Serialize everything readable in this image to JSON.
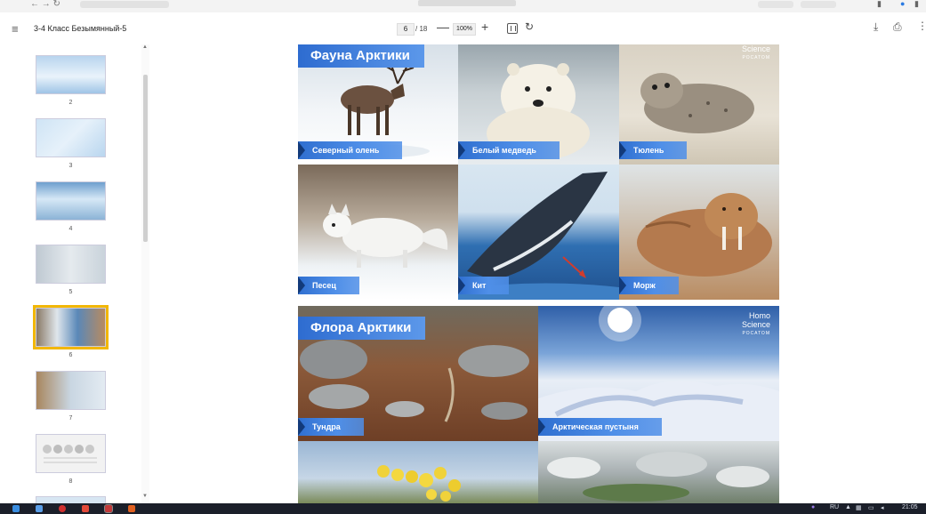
{
  "browser": {
    "nav_icons": "← →  ↻"
  },
  "toolbar": {
    "menu_icon": "≡",
    "doc_title": "3-4 Класс Безымянный-5",
    "current_page": "6",
    "page_total": "/ 18",
    "zoom_out": "—",
    "zoom": "100%",
    "zoom_in": "+",
    "rotate_icon": "↻",
    "download_icon": "⤓",
    "print_icon": "⎙",
    "more_icon": "⋮"
  },
  "sidebar": {
    "thumbnails": [
      {
        "num": "2"
      },
      {
        "num": "3"
      },
      {
        "num": "4"
      },
      {
        "num": "5"
      },
      {
        "num": "6",
        "selected": true
      },
      {
        "num": "7"
      },
      {
        "num": "8"
      }
    ]
  },
  "slide_fauna": {
    "title": "Фауна Арктики",
    "logo_line1": "Science",
    "logo_line2": "РОСАТОМ",
    "cells": [
      {
        "caption": "Северный олень"
      },
      {
        "caption": "Белый медведь"
      },
      {
        "caption": "Тюлень"
      },
      {
        "caption": "Песец"
      },
      {
        "caption": "Кит"
      },
      {
        "caption": "Морж"
      }
    ]
  },
  "slide_flora": {
    "title": "Флора Арктики",
    "logo_line1": "Homo",
    "logo_line2": "Science",
    "logo_line3": "РОСАТОМ",
    "cells": [
      {
        "caption": "Тундра"
      },
      {
        "caption": "Арктическая пустыня"
      }
    ]
  },
  "taskbar": {
    "lang": "RU",
    "time": "21:05"
  },
  "colors": {
    "selected_thumb": "#f2b705",
    "caption_blue": "#2f6fd0"
  }
}
